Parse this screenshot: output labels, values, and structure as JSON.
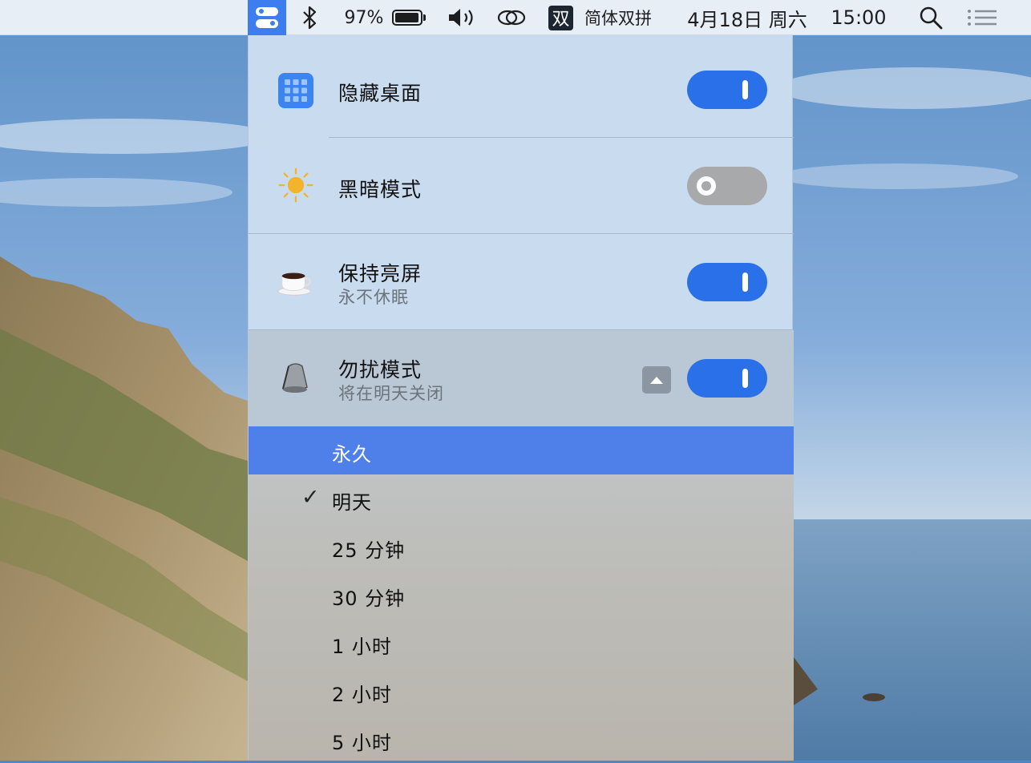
{
  "menubar": {
    "app_icon": "toggles-icon",
    "bluetooth_icon": "bluetooth-icon",
    "battery_percent": "97%",
    "battery_level": 0.97,
    "volume_icon": "volume-icon",
    "link_icon": "link-icon",
    "ime_badge": "双",
    "ime_name": "简体双拼",
    "date": "4月18日 周六",
    "time": "15:00",
    "search_icon": "search-icon",
    "list_icon": "list-icon"
  },
  "panel": {
    "rows": [
      {
        "title": "隐藏桌面",
        "icon": "grid-icon",
        "on": true
      },
      {
        "title": "黑暗模式",
        "icon": "sun-icon",
        "on": false
      },
      {
        "title": "保持亮屏",
        "subtitle": "永不休眠",
        "icon": "coffee-icon",
        "on": true
      },
      {
        "title": "勿扰模式",
        "subtitle": "将在明天关闭",
        "icon": "bell-icon",
        "on": true,
        "expanded": true
      }
    ]
  },
  "menu": {
    "items": [
      {
        "label": "永久",
        "highlighted": true,
        "checked": false
      },
      {
        "label": "明天",
        "highlighted": false,
        "checked": true
      },
      {
        "label": "25 分钟",
        "highlighted": false,
        "checked": false
      },
      {
        "label": "30 分钟",
        "highlighted": false,
        "checked": false
      },
      {
        "label": "1 小时",
        "highlighted": false,
        "checked": false
      },
      {
        "label": "2 小时",
        "highlighted": false,
        "checked": false
      },
      {
        "label": "5 小时",
        "highlighted": false,
        "checked": false
      }
    ],
    "check_glyph": "✓"
  },
  "colors": {
    "accent": "#2a70e8",
    "menu_highlight": "#4f7fe9",
    "toggle_off": "#a7a9ab"
  }
}
